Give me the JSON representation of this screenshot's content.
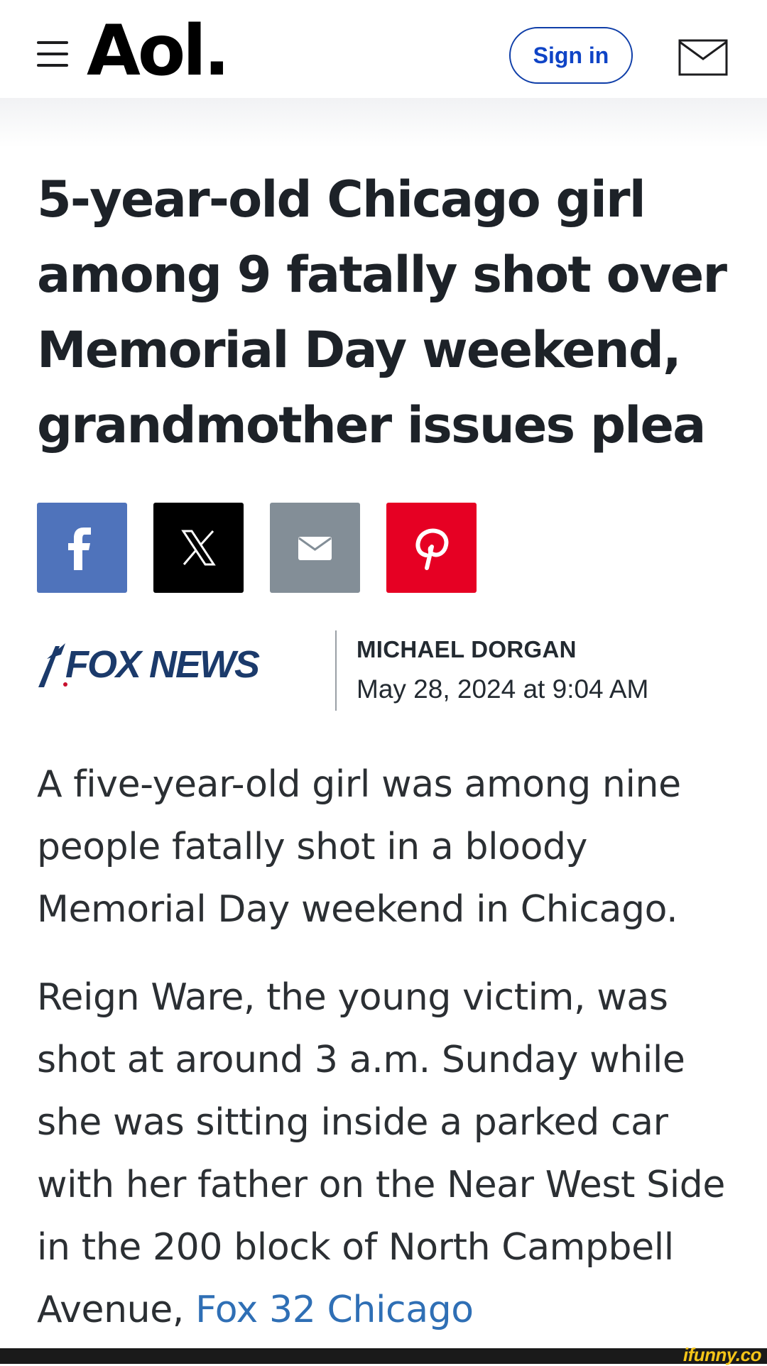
{
  "header": {
    "logo_text": "Aol.",
    "signin_label": "Sign in",
    "menu_icon": "hamburger-menu-icon",
    "mail_icon": "mail-icon"
  },
  "article": {
    "title": "5-year-old Chicago girl among 9 fatally shot over Memorial Day weekend, grandmother issues plea",
    "share": {
      "facebook_icon": "facebook-icon",
      "x_icon": "x-icon",
      "email_icon": "email-icon",
      "pinterest_icon": "pinterest-icon"
    },
    "source_logo": "FOX NEWS",
    "author": "MICHAEL DORGAN",
    "date": "May 28, 2024 at 9:04 AM",
    "paragraph1": "A five-year-old girl was among nine people fatally shot in a bloody Memorial Day weekend in Chicago.",
    "paragraph2_text": "Reign Ware, the young victim, was shot at around 3 a.m. Sunday while she was sitting inside a parked car with her father on the Near West Side in the 200 block of North Campbell Avenue, ",
    "paragraph2_link": "Fox 32 Chicago"
  },
  "watermark": "ifunny.co",
  "colors": {
    "signin_blue": "#0f44c6",
    "facebook": "#4f73bb",
    "x": "#000000",
    "email": "#838e97",
    "pinterest": "#e60023",
    "link": "#2f6fb5",
    "fox_navy": "#1b3a6b"
  }
}
